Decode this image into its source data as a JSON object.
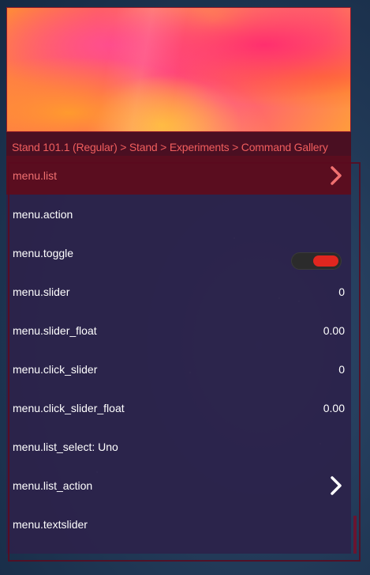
{
  "breadcrumb": "Stand 101.1 (Regular) > Stand > Experiments > Command Gallery",
  "items": [
    {
      "label": "menu.list",
      "value": ""
    },
    {
      "label": "menu.action",
      "value": ""
    },
    {
      "label": "menu.toggle",
      "value": ""
    },
    {
      "label": "menu.slider",
      "value": "0"
    },
    {
      "label": "menu.slider_float",
      "value": "0.00"
    },
    {
      "label": "menu.click_slider",
      "value": "0"
    },
    {
      "label": "menu.click_slider_float",
      "value": "0.00"
    },
    {
      "label": "menu.list_select: Uno",
      "value": ""
    },
    {
      "label": "menu.list_action",
      "value": ""
    },
    {
      "label": "menu.textslider",
      "value": ""
    }
  ],
  "toggle_state": "on",
  "colors": {
    "accent": "#f05d5d",
    "active_row": "#5a0d1f",
    "list_bg": "#2c224a",
    "toggle_on": "#e0261f"
  },
  "icons": {
    "list_arrow": "chevron-right-icon",
    "list_action_arrow": "chevron-right-icon"
  }
}
